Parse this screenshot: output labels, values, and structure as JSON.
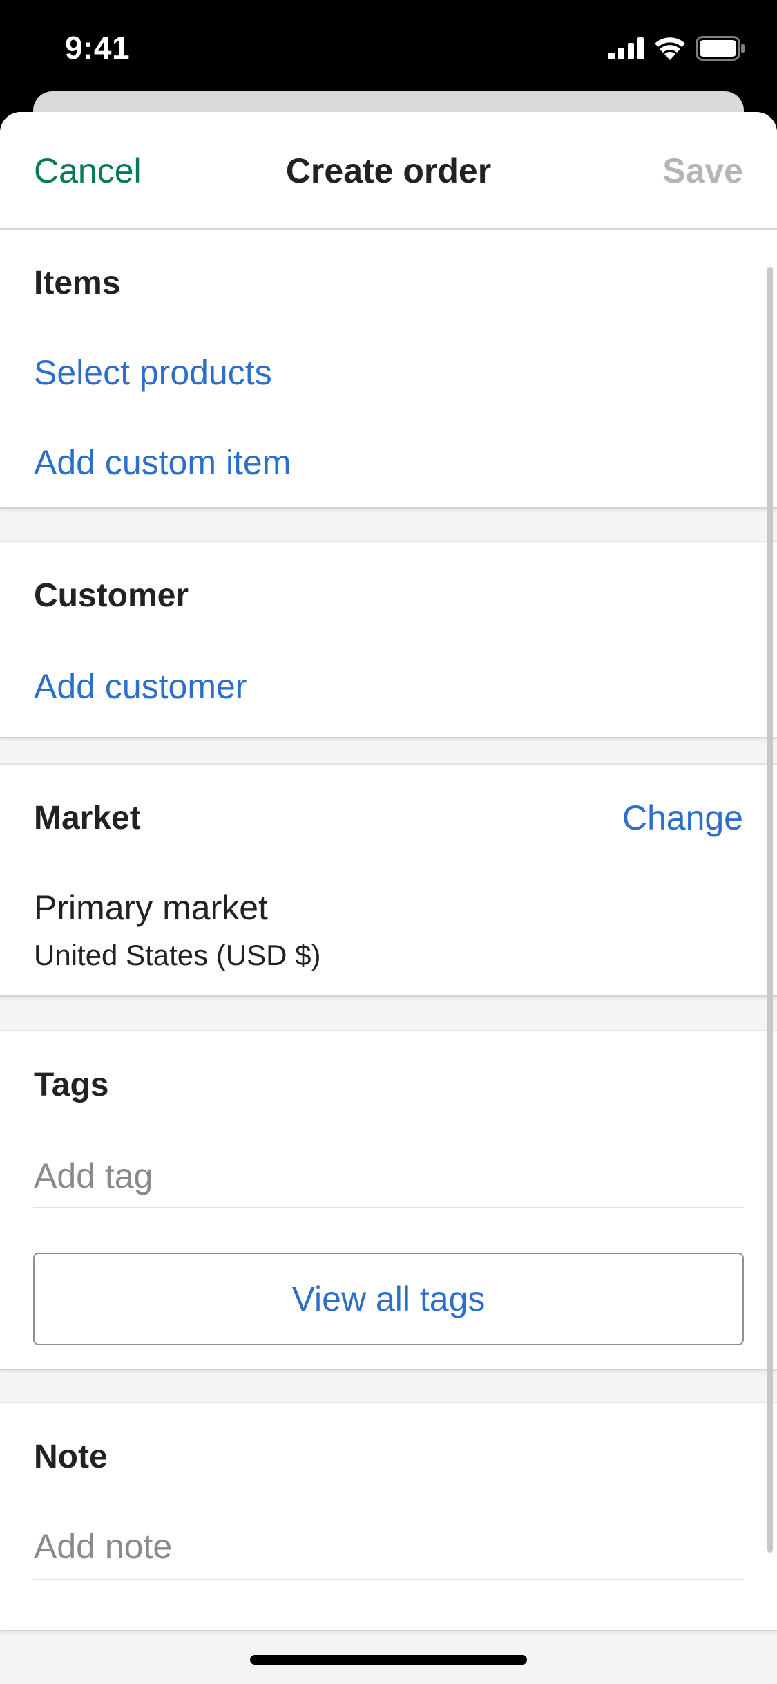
{
  "status_bar": {
    "time": "9:41",
    "icons": [
      "signal-icon",
      "wifi-icon",
      "battery-icon"
    ]
  },
  "navbar": {
    "cancel_label": "Cancel",
    "title": "Create order",
    "save_label": "Save"
  },
  "items_section": {
    "heading": "Items",
    "select_products_label": "Select products",
    "add_custom_item_label": "Add custom item"
  },
  "customer_section": {
    "heading": "Customer",
    "add_customer_label": "Add customer"
  },
  "market_section": {
    "heading": "Market",
    "change_label": "Change",
    "market_name": "Primary market",
    "market_region": "United States (USD $)"
  },
  "tags_section": {
    "heading": "Tags",
    "input_placeholder": "Add tag",
    "view_all_label": "View all tags"
  },
  "note_section": {
    "heading": "Note",
    "input_placeholder": "Add note"
  },
  "colors": {
    "accent_green": "#087a5b",
    "link_blue": "#2c6ecb",
    "disabled_gray": "#b5b5b5"
  }
}
